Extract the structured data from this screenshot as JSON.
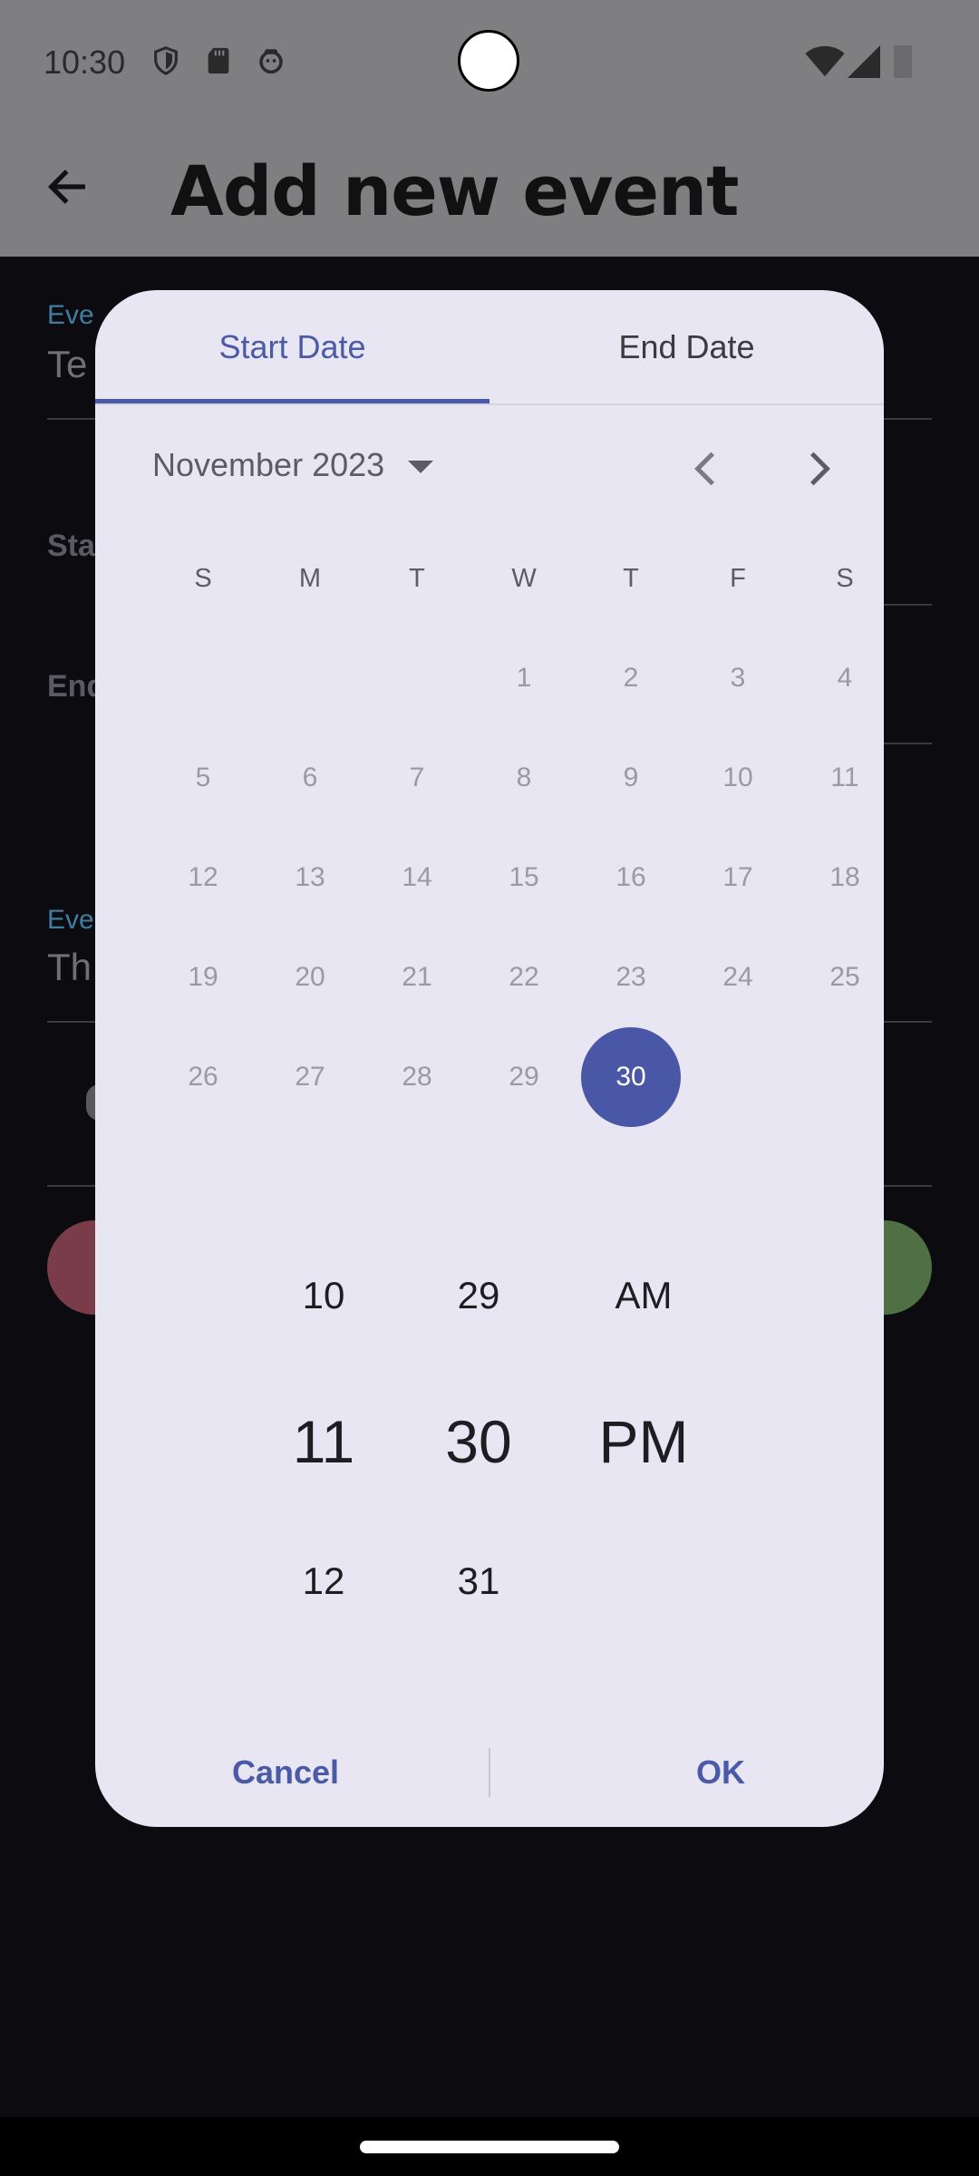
{
  "status_bar": {
    "time": "10:30",
    "icons": [
      "shield-icon",
      "sd-card-icon",
      "android-face-icon",
      "wifi-icon",
      "signal-icon",
      "battery-icon"
    ]
  },
  "app_bar": {
    "title": "Add new event",
    "back_icon": "arrow-back-icon"
  },
  "background_form": {
    "event_name_label_partial": "Eve",
    "event_name_value_partial": "Te",
    "start_label_partial": "Sta",
    "end_label_partial": "End",
    "event_desc_label_partial": "Eve",
    "event_desc_value_partial": "Th"
  },
  "dialog": {
    "tabs": [
      {
        "label": "Start Date",
        "selected": true
      },
      {
        "label": "End Date",
        "selected": false
      }
    ],
    "calendar": {
      "month_label": "November 2023",
      "weekdays": [
        "S",
        "M",
        "T",
        "W",
        "T",
        "F",
        "S"
      ],
      "weeks": [
        [
          "",
          "",
          "",
          "1",
          "2",
          "3",
          "4"
        ],
        [
          "5",
          "6",
          "7",
          "8",
          "9",
          "10",
          "11"
        ],
        [
          "12",
          "13",
          "14",
          "15",
          "16",
          "17",
          "18"
        ],
        [
          "19",
          "20",
          "21",
          "22",
          "23",
          "24",
          "25"
        ],
        [
          "26",
          "27",
          "28",
          "29",
          "30",
          "",
          ""
        ]
      ],
      "selected_day": "30"
    },
    "time_picker": {
      "hours": {
        "prev": "10",
        "current": "11",
        "next": "12"
      },
      "minutes": {
        "prev": "29",
        "current": "30",
        "next": "31"
      },
      "period": {
        "prev": "AM",
        "current": "PM"
      }
    },
    "buttons": {
      "cancel": "Cancel",
      "ok": "OK"
    }
  },
  "colors": {
    "accent": "#4a56a6",
    "dialog_bg": "#e9e6f4",
    "scrim": "#7f7e80"
  }
}
